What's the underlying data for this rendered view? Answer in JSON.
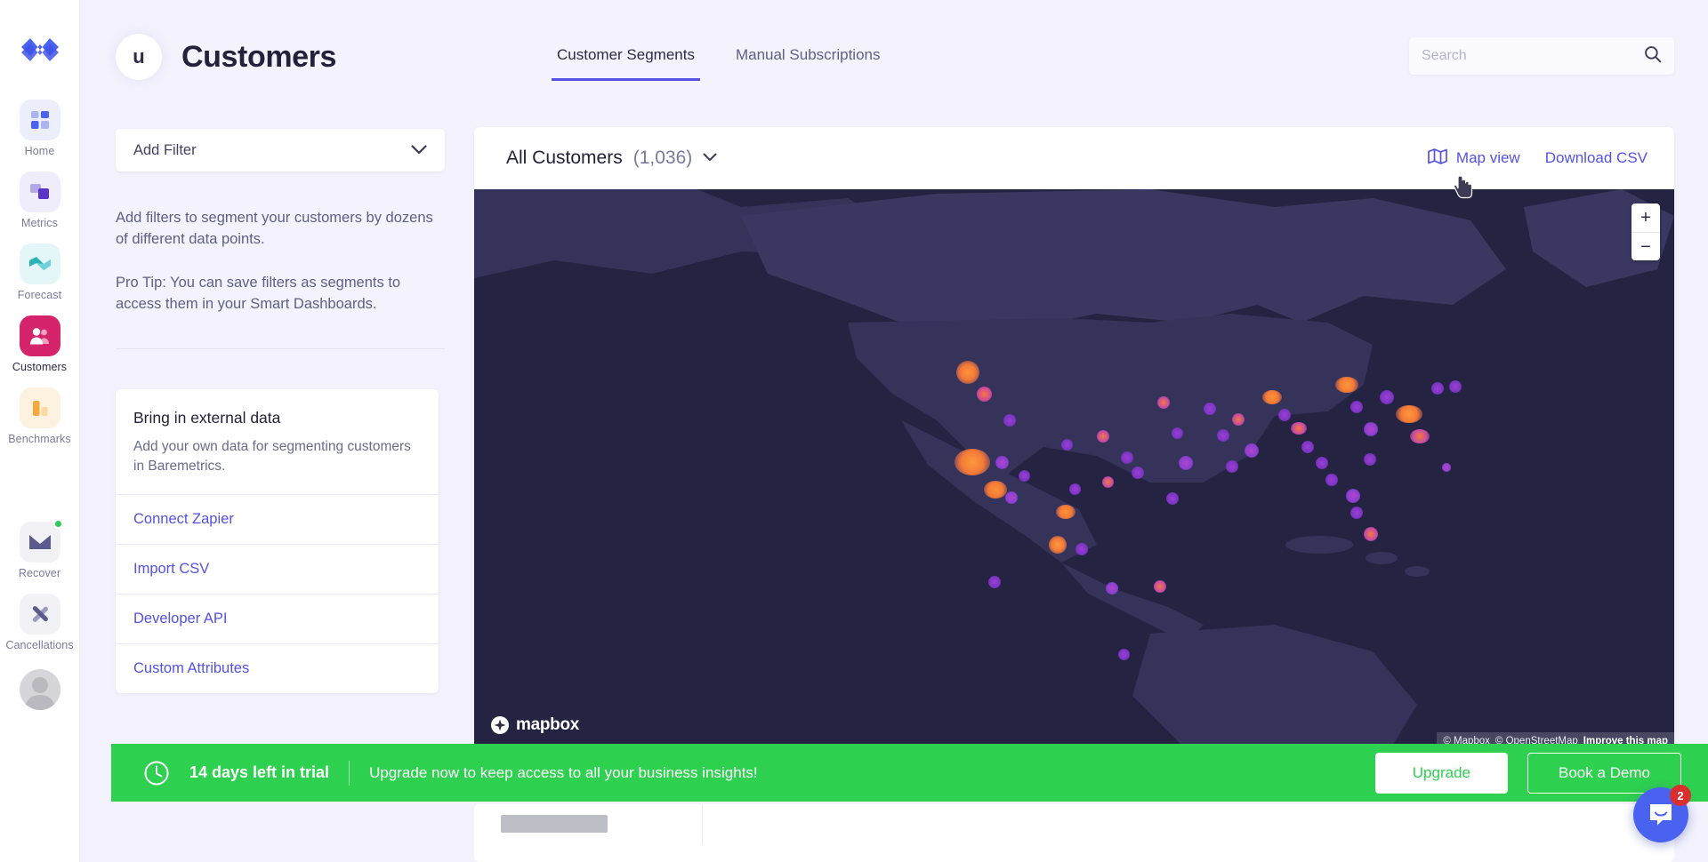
{
  "app": {
    "brand": "baremetrics-logo"
  },
  "sidebar": {
    "items": [
      {
        "label": "Home",
        "icon": "grid-icon",
        "active": false
      },
      {
        "label": "Metrics",
        "icon": "layers-icon",
        "active": false
      },
      {
        "label": "Forecast",
        "icon": "forecast-icon",
        "active": false
      },
      {
        "label": "Customers",
        "icon": "customers-icon",
        "active": true
      },
      {
        "label": "Benchmarks",
        "icon": "bar-chart-icon",
        "active": false
      },
      {
        "label": "Recover",
        "icon": "envelope-icon",
        "active": false,
        "badge": true
      },
      {
        "label": "Cancellations",
        "icon": "x-cross-icon",
        "active": false
      }
    ]
  },
  "header": {
    "avatar_initial": "u",
    "title": "Customers",
    "tabs": [
      {
        "label": "Customer Segments",
        "active": true
      },
      {
        "label": "Manual Subscriptions",
        "active": false
      }
    ],
    "search": {
      "value": "",
      "placeholder": "Search",
      "icon": "search-icon"
    }
  },
  "left_panel": {
    "filter": {
      "label": "Add Filter",
      "icon": "chevron-down-icon"
    },
    "help_paragraphs": [
      "Add filters to segment your customers by dozens of different data points.",
      "Pro Tip: You can save filters as segments to access them in your Smart Dashboards."
    ],
    "external_card": {
      "title": "Bring in external data",
      "subtitle": "Add your own data for segmenting customers in Baremetrics.",
      "links": [
        "Connect Zapier",
        "Import CSV",
        "Developer API",
        "Custom Attributes"
      ]
    }
  },
  "map_panel": {
    "segment_name": "All Customers",
    "segment_count": "(1,036)",
    "segment_chevron": "chevron-down-icon",
    "map_view_label": "Map view",
    "map_view_icon": "map-icon",
    "download_label": "Download CSV",
    "zoom_in": "+",
    "zoom_out": "−",
    "mapbox_label": "mapbox",
    "attribution": {
      "mapbox": "© Mapbox",
      "osm": "© OpenStreetMap",
      "improve": "Improve this map"
    },
    "colors": {
      "ocean": "#252342",
      "land": "#35335a",
      "dot_hot": "#f57a37",
      "dot_cool": "#8a3fd1"
    }
  },
  "trial_banner": {
    "icon": "clock-icon",
    "days_text": "14 days left in trial",
    "message": "Upgrade now to keep access to all your business insights!",
    "upgrade_label": "Upgrade",
    "demo_label": "Book a Demo",
    "color": "#2ed04f"
  },
  "chat": {
    "icon": "chat-bubble-icon",
    "badge": "2",
    "color": "#4a62f0"
  }
}
